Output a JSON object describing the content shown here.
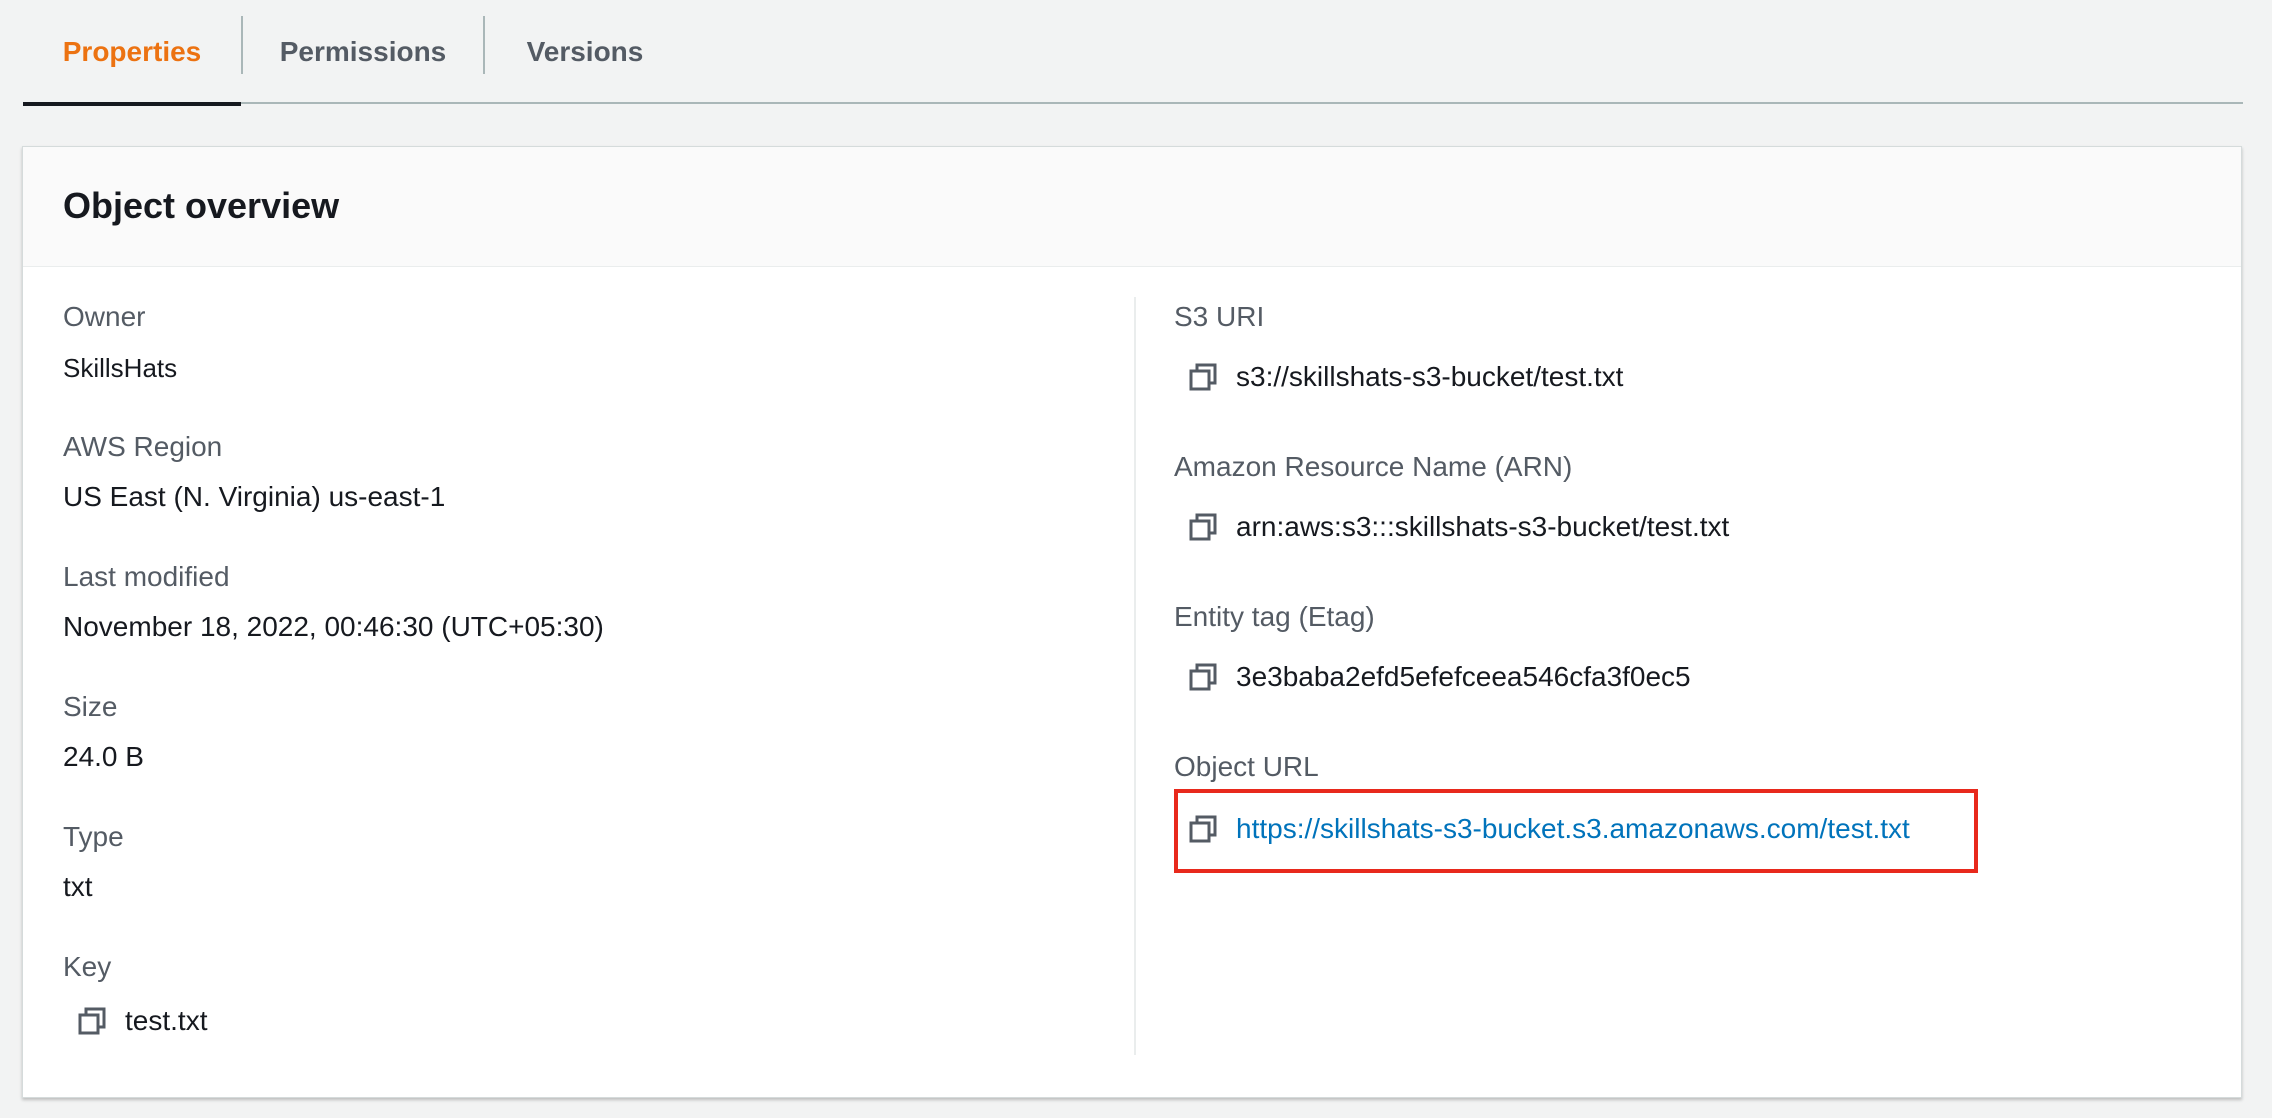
{
  "tabs": [
    {
      "label": "Properties",
      "active": true
    },
    {
      "label": "Permissions",
      "active": false
    },
    {
      "label": "Versions",
      "active": false
    }
  ],
  "overview": {
    "title": "Object overview",
    "left": {
      "owner_label": "Owner",
      "owner_value": "SkillsHats",
      "region_label": "AWS Region",
      "region_value": "US East (N. Virginia) us-east-1",
      "modified_label": "Last modified",
      "modified_value": "November 18, 2022, 00:46:30 (UTC+05:30)",
      "size_label": "Size",
      "size_value": "24.0 B",
      "type_label": "Type",
      "type_value": "txt",
      "key_label": "Key",
      "key_value": "test.txt"
    },
    "right": {
      "s3uri_label": "S3 URI",
      "s3uri_value": "s3://skillshats-s3-bucket/test.txt",
      "arn_label": "Amazon Resource Name (ARN)",
      "arn_value": "arn:aws:s3:::skillshats-s3-bucket/test.txt",
      "etag_label": "Entity tag (Etag)",
      "etag_value": "3e3baba2efd5efefceea546cfa3f0ec5",
      "url_label": "Object URL",
      "url_value": "https://skillshats-s3-bucket.s3.amazonaws.com/test.txt"
    }
  },
  "colors": {
    "active_tab": "#ec7211",
    "link": "#0073bb",
    "highlight": "#e8291c"
  },
  "icons": {
    "copy": "copy-icon"
  }
}
